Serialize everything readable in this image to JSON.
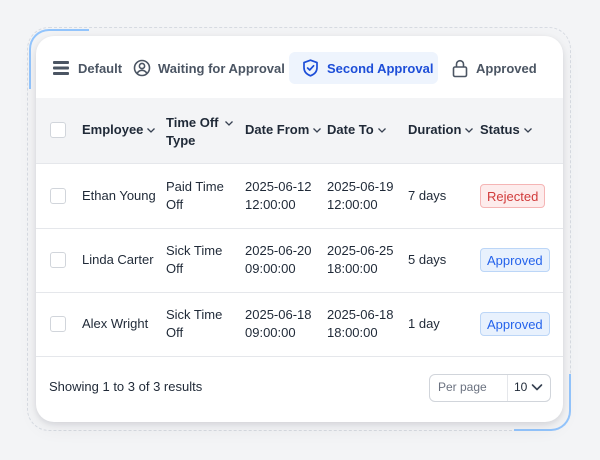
{
  "tabs": [
    {
      "label": "Default",
      "icon": "list-icon"
    },
    {
      "label": "Waiting for Approval",
      "icon": "user-circle-icon"
    },
    {
      "label": "Second Approval",
      "icon": "shield-check-icon",
      "active": true
    },
    {
      "label": "Approved",
      "icon": "lock-icon"
    }
  ],
  "table": {
    "columns": [
      "Employee",
      "Time Off Type",
      "Date From",
      "Date To",
      "Duration",
      "Status"
    ],
    "column_header_lines": {
      "time_off_type": [
        "Time Off",
        "Type"
      ]
    },
    "rows": [
      {
        "employee": "Ethan Young",
        "type": [
          "Paid Time",
          "Off"
        ],
        "date_from": [
          "2025-06-12",
          "12:00:00"
        ],
        "date_to": [
          "2025-06-19",
          "12:00:00"
        ],
        "duration": "7 days",
        "status": "Rejected"
      },
      {
        "employee": "Linda Carter",
        "type": [
          "Sick Time",
          "Off"
        ],
        "date_from": [
          "2025-06-20",
          "09:00:00"
        ],
        "date_to": [
          "2025-06-25",
          "18:00:00"
        ],
        "duration": "5 days",
        "status": "Approved"
      },
      {
        "employee": "Alex Wright",
        "type": [
          "Sick Time",
          "Off"
        ],
        "date_from": [
          "2025-06-18",
          "09:00:00"
        ],
        "date_to": [
          "2025-06-18",
          "18:00:00"
        ],
        "duration": "1 day",
        "status": "Approved"
      }
    ]
  },
  "footer": {
    "results_text": "Showing 1 to 3 of 3 results",
    "per_page_placeholder": "Per page",
    "per_page_value": "10"
  },
  "colors": {
    "accent": "#1d4ed8",
    "rejected": "#d13b3b",
    "approved": "#2563eb"
  }
}
